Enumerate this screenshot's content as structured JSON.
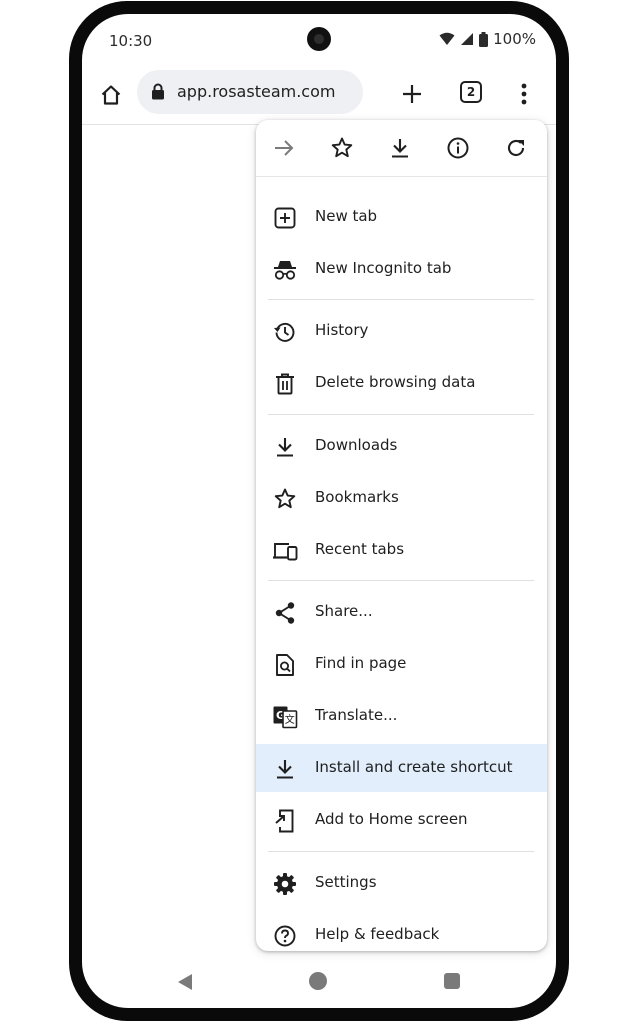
{
  "status_bar": {
    "time": "10:30",
    "battery": "100%"
  },
  "toolbar": {
    "url": "app.rosasteam.com",
    "tab_count": "2"
  },
  "menu": {
    "top_icons": [
      "forward-icon",
      "bookmark-star-icon",
      "download-icon",
      "info-icon",
      "refresh-icon"
    ],
    "items": [
      {
        "label": "New tab",
        "icon": "new-tab-icon"
      },
      {
        "label": "New Incognito tab",
        "icon": "incognito-icon"
      },
      {
        "label": "History",
        "icon": "history-icon"
      },
      {
        "label": "Delete browsing data",
        "icon": "trash-icon"
      },
      {
        "label": "Downloads",
        "icon": "download-icon"
      },
      {
        "label": "Bookmarks",
        "icon": "star-icon"
      },
      {
        "label": "Recent tabs",
        "icon": "devices-icon"
      },
      {
        "label": "Share...",
        "icon": "share-icon"
      },
      {
        "label": "Find in page",
        "icon": "find-in-page-icon"
      },
      {
        "label": "Translate...",
        "icon": "translate-icon"
      },
      {
        "label": "Install and create shortcut",
        "icon": "install-icon",
        "highlighted": true
      },
      {
        "label": "Add to Home screen",
        "icon": "add-to-home-icon"
      },
      {
        "label": "Settings",
        "icon": "gear-icon"
      },
      {
        "label": "Help & feedback",
        "icon": "help-icon"
      }
    ]
  },
  "colors": {
    "highlight": "#e2eefc",
    "icon": "#1f1f1f",
    "omnibox": "#eef0f3"
  }
}
